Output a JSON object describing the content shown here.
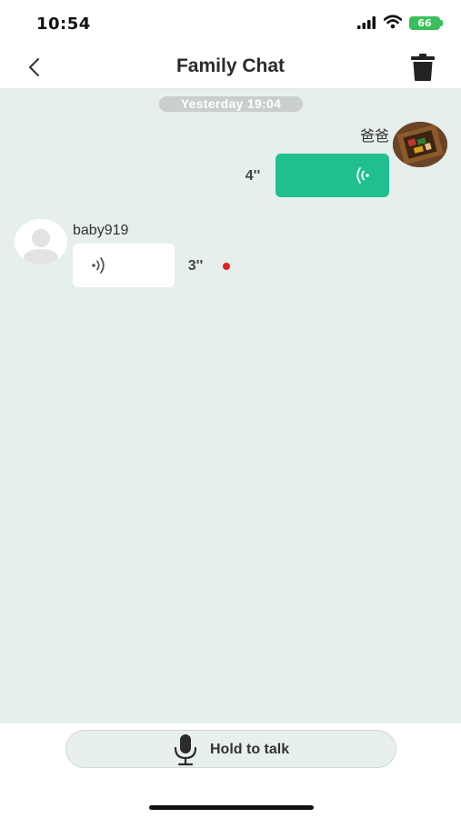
{
  "status_bar": {
    "time": "10:54",
    "battery": "66",
    "battery_color": "#3ac05a"
  },
  "header": {
    "title": "Family Chat",
    "back_icon": "chevron-left-icon",
    "delete_icon": "trash-icon"
  },
  "chat": {
    "background": "#e5efec",
    "timestamp": "Yesterday 19:04",
    "messages": [
      {
        "direction": "sent",
        "sender": "爸爸",
        "type": "voice",
        "duration": "4''",
        "bubble_color": "#1fbf8f"
      },
      {
        "direction": "received",
        "sender": "baby919",
        "type": "voice",
        "duration": "3''",
        "unread": true
      }
    ]
  },
  "footer": {
    "hold_to_talk": "Hold to talk",
    "mic_icon": "microphone-icon"
  }
}
